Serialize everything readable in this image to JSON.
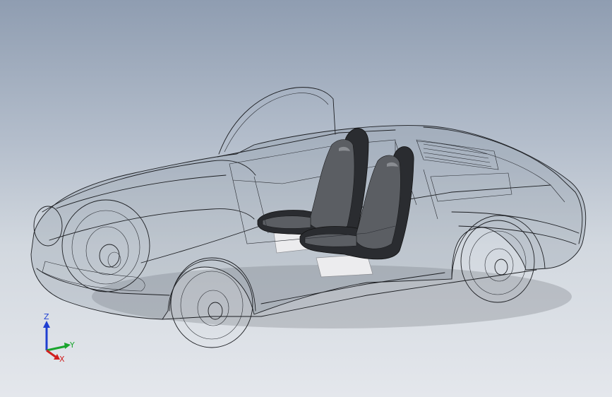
{
  "viewport": {
    "background_top": "#8f9db1",
    "background_bottom": "#e4e7ec",
    "display_mode": "hidden-lines-visible",
    "model": "car-assembly-wireframe"
  },
  "triad": {
    "z_label": "Z",
    "y_label": "Y",
    "x_label": "X",
    "z_color": "#1f3fd1",
    "y_color": "#1aa52e",
    "x_color": "#d11f1f"
  }
}
